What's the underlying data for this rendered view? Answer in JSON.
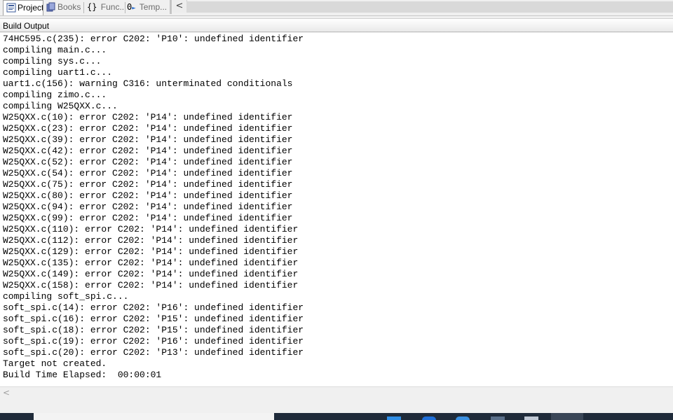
{
  "tabs": [
    {
      "label": "Project",
      "icon": "project-icon"
    },
    {
      "label": "Books",
      "icon": "books-icon"
    },
    {
      "label": "Func...",
      "icon": "braces-icon"
    },
    {
      "label": "Temp...",
      "icon": "template-icon"
    }
  ],
  "scroll_left_glyph": "<",
  "panel": {
    "title": "Build Output"
  },
  "output_lines": [
    "74HC595.c(235): error C202: 'P10': undefined identifier",
    "compiling main.c...",
    "compiling sys.c...",
    "compiling uart1.c...",
    "uart1.c(156): warning C316: unterminated conditionals",
    "compiling zimo.c...",
    "compiling W25QXX.c...",
    "W25QXX.c(10): error C202: 'P14': undefined identifier",
    "W25QXX.c(23): error C202: 'P14': undefined identifier",
    "W25QXX.c(39): error C202: 'P14': undefined identifier",
    "W25QXX.c(42): error C202: 'P14': undefined identifier",
    "W25QXX.c(52): error C202: 'P14': undefined identifier",
    "W25QXX.c(54): error C202: 'P14': undefined identifier",
    "W25QXX.c(75): error C202: 'P14': undefined identifier",
    "W25QXX.c(80): error C202: 'P14': undefined identifier",
    "W25QXX.c(94): error C202: 'P14': undefined identifier",
    "W25QXX.c(99): error C202: 'P14': undefined identifier",
    "W25QXX.c(110): error C202: 'P14': undefined identifier",
    "W25QXX.c(112): error C202: 'P14': undefined identifier",
    "W25QXX.c(129): error C202: 'P14': undefined identifier",
    "W25QXX.c(135): error C202: 'P14': undefined identifier",
    "W25QXX.c(149): error C202: 'P14': undefined identifier",
    "W25QXX.c(158): error C202: 'P14': undefined identifier",
    "compiling soft_spi.c...",
    "soft_spi.c(14): error C202: 'P16': undefined identifier",
    "soft_spi.c(16): error C202: 'P15': undefined identifier",
    "soft_spi.c(18): error C202: 'P15': undefined identifier",
    "soft_spi.c(19): error C202: 'P16': undefined identifier",
    "soft_spi.c(20): error C202: 'P13': undefined identifier",
    "Target not created.",
    "Build Time Elapsed:  00:00:01"
  ],
  "hscroll": {
    "left_glyph": "<"
  },
  "colors": {
    "output_bg": "#ffffff",
    "text": "#000000",
    "taskbar": "#1f2b3a"
  }
}
